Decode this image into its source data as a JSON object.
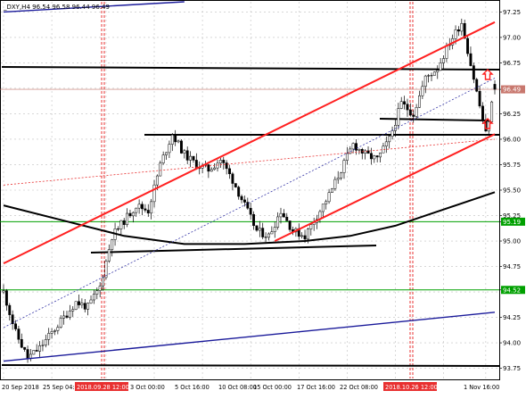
{
  "symbol_line": "_DXY,H4  96.54 96.58 96.44 96.49",
  "chart_data": {
    "type": "candlestick",
    "title": "_DXY,H4  96.54 96.58 96.44 96.49",
    "symbol": "_DXY",
    "timeframe": "H4",
    "last_bar": {
      "open": 96.54,
      "high": 96.58,
      "low": 96.44,
      "close": 96.49
    },
    "current_price": 96.49,
    "ylim": [
      93.65,
      97.35
    ],
    "y_ticks": [
      "97.25",
      "97.00",
      "96.75",
      "96.49",
      "96.25",
      "96.00",
      "95.75",
      "95.50",
      "95.25",
      "95.19",
      "95.00",
      "94.75",
      "94.52",
      "94.25",
      "94.00",
      "93.75"
    ],
    "x_ticks": [
      "20 Sep 2018",
      "25 Sep 04:00",
      "2018.09.28 12:00",
      "3 Oct 00:00",
      "5 Oct 16:00",
      "10 Oct 08:00",
      "15 Oct 00:00",
      "17 Oct 16:00",
      "22 Oct 08:00",
      "2018.10.26 12:00",
      "1 Nov 16:00"
    ],
    "period_separator_labels": [
      "2018.09.28 12:00",
      "2018.10.26 12:00"
    ],
    "horizontal_levels": [
      95.19,
      94.52
    ],
    "bar_count": 164,
    "close_anchors": [
      [
        0,
        94.5
      ],
      [
        4,
        94.1
      ],
      [
        8,
        93.85
      ],
      [
        12,
        93.95
      ],
      [
        16,
        94.1
      ],
      [
        20,
        94.25
      ],
      [
        24,
        94.4
      ],
      [
        28,
        94.35
      ],
      [
        32,
        94.55
      ],
      [
        36,
        95.05
      ],
      [
        40,
        95.2
      ],
      [
        44,
        95.35
      ],
      [
        48,
        95.3
      ],
      [
        52,
        95.75
      ],
      [
        56,
        96.05
      ],
      [
        60,
        95.85
      ],
      [
        64,
        95.75
      ],
      [
        68,
        95.7
      ],
      [
        72,
        95.8
      ],
      [
        76,
        95.6
      ],
      [
        80,
        95.35
      ],
      [
        84,
        95.1
      ],
      [
        88,
        95.05
      ],
      [
        92,
        95.3
      ],
      [
        96,
        95.1
      ],
      [
        100,
        95.05
      ],
      [
        104,
        95.25
      ],
      [
        108,
        95.45
      ],
      [
        112,
        95.7
      ],
      [
        116,
        95.95
      ],
      [
        120,
        95.85
      ],
      [
        124,
        95.8
      ],
      [
        128,
        96.0
      ],
      [
        132,
        96.35
      ],
      [
        136,
        96.25
      ],
      [
        140,
        96.6
      ],
      [
        144,
        96.7
      ],
      [
        148,
        96.95
      ],
      [
        152,
        97.15
      ],
      [
        156,
        96.6
      ],
      [
        160,
        96.05
      ],
      [
        163,
        96.49
      ]
    ],
    "ma_path": [
      [
        0,
        95.35
      ],
      [
        20,
        95.2
      ],
      [
        40,
        95.05
      ],
      [
        60,
        94.97
      ],
      [
        80,
        94.97
      ],
      [
        100,
        95.0
      ],
      [
        115,
        95.05
      ],
      [
        130,
        95.15
      ],
      [
        145,
        95.3
      ],
      [
        163,
        95.48
      ]
    ],
    "trend_lines": [
      {
        "name": "channel-upper",
        "points": [
          [
            0,
            94.78
          ],
          [
            163,
            97.15
          ]
        ]
      },
      {
        "name": "channel-lower",
        "points": [
          [
            90,
            95.0
          ],
          [
            163,
            96.05
          ]
        ]
      },
      {
        "name": "long-trend-upper-blue",
        "points": [
          [
            0,
            97.25
          ],
          [
            60,
            97.35
          ]
        ]
      },
      {
        "name": "long-trend-lower-blue",
        "points": [
          [
            0,
            93.82
          ],
          [
            163,
            94.3
          ]
        ]
      },
      {
        "name": "median-line",
        "points": [
          [
            0,
            94.15
          ],
          [
            163,
            96.6
          ]
        ]
      },
      {
        "name": "red-dotted-line",
        "points": [
          [
            0,
            95.55
          ],
          [
            163,
            96.0
          ]
        ]
      }
    ],
    "grid": true,
    "legend": "none"
  }
}
